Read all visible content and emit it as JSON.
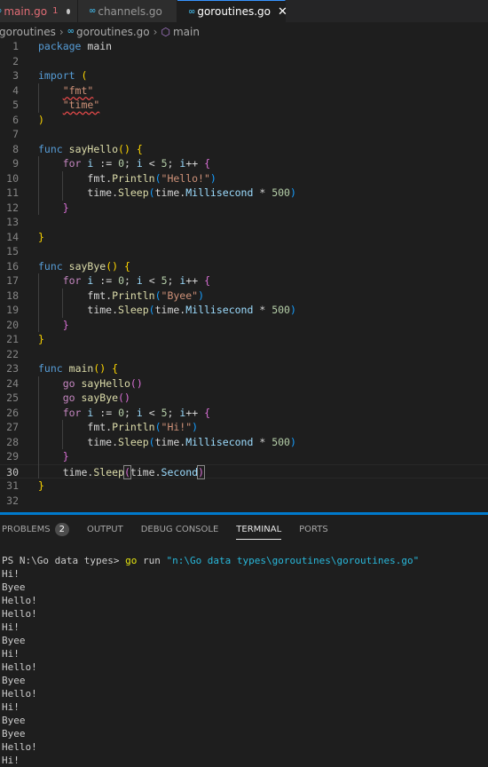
{
  "tabs": [
    {
      "label": "main.go",
      "count": "1"
    },
    {
      "label": "channels.go"
    },
    {
      "label": "goroutines.go"
    }
  ],
  "breadcrumb": {
    "folder": "goroutines",
    "file": "goroutines.go",
    "symbol": "main"
  },
  "code_lines": [
    "package main",
    "",
    "import (",
    "\t\"fmt\"",
    "\t\"time\"",
    ")",
    "",
    "func sayHello() {",
    "\tfor i := 0; i < 5; i++ {",
    "\t\tfmt.Println(\"Hello!\")",
    "\t\ttime.Sleep(time.Millisecond * 500)",
    "\t}",
    "",
    "}",
    "",
    "func sayBye() {",
    "\tfor i := 0; i < 5; i++ {",
    "\t\tfmt.Println(\"Byee\")",
    "\t\ttime.Sleep(time.Millisecond * 500)",
    "\t}",
    "}",
    "",
    "func main() {",
    "\tgo sayHello()",
    "\tgo sayBye()",
    "\tfor i := 0; i < 5; i++ {",
    "\t\tfmt.Println(\"Hi!\")",
    "\t\ttime.Sleep(time.Millisecond * 500)",
    "\t}",
    "\ttime.Sleep(time.Second)",
    "}",
    ""
  ],
  "current_line": 30,
  "panel": {
    "tabs": [
      "PROBLEMS",
      "OUTPUT",
      "DEBUG CONSOLE",
      "TERMINAL",
      "PORTS"
    ],
    "active_tab": "TERMINAL",
    "problems_count": "2"
  },
  "terminal": {
    "prompt": "PS N:\\Go data types> ",
    "command": "go",
    "args": " run ",
    "path": "\"n:\\Go data types\\goroutines\\goroutines.go\"",
    "output": [
      "Hi!",
      "Byee",
      "Hello!",
      "Hello!",
      "Hi!",
      "Byee",
      "Hi!",
      "Hello!",
      "Byee",
      "Hello!",
      "Hi!",
      "Byee",
      "Byee",
      "Hello!",
      "Hi!"
    ]
  },
  "colors": {
    "accent": "#007acc",
    "background": "#1e1e1e",
    "go_icon": "#3fa9d4"
  }
}
